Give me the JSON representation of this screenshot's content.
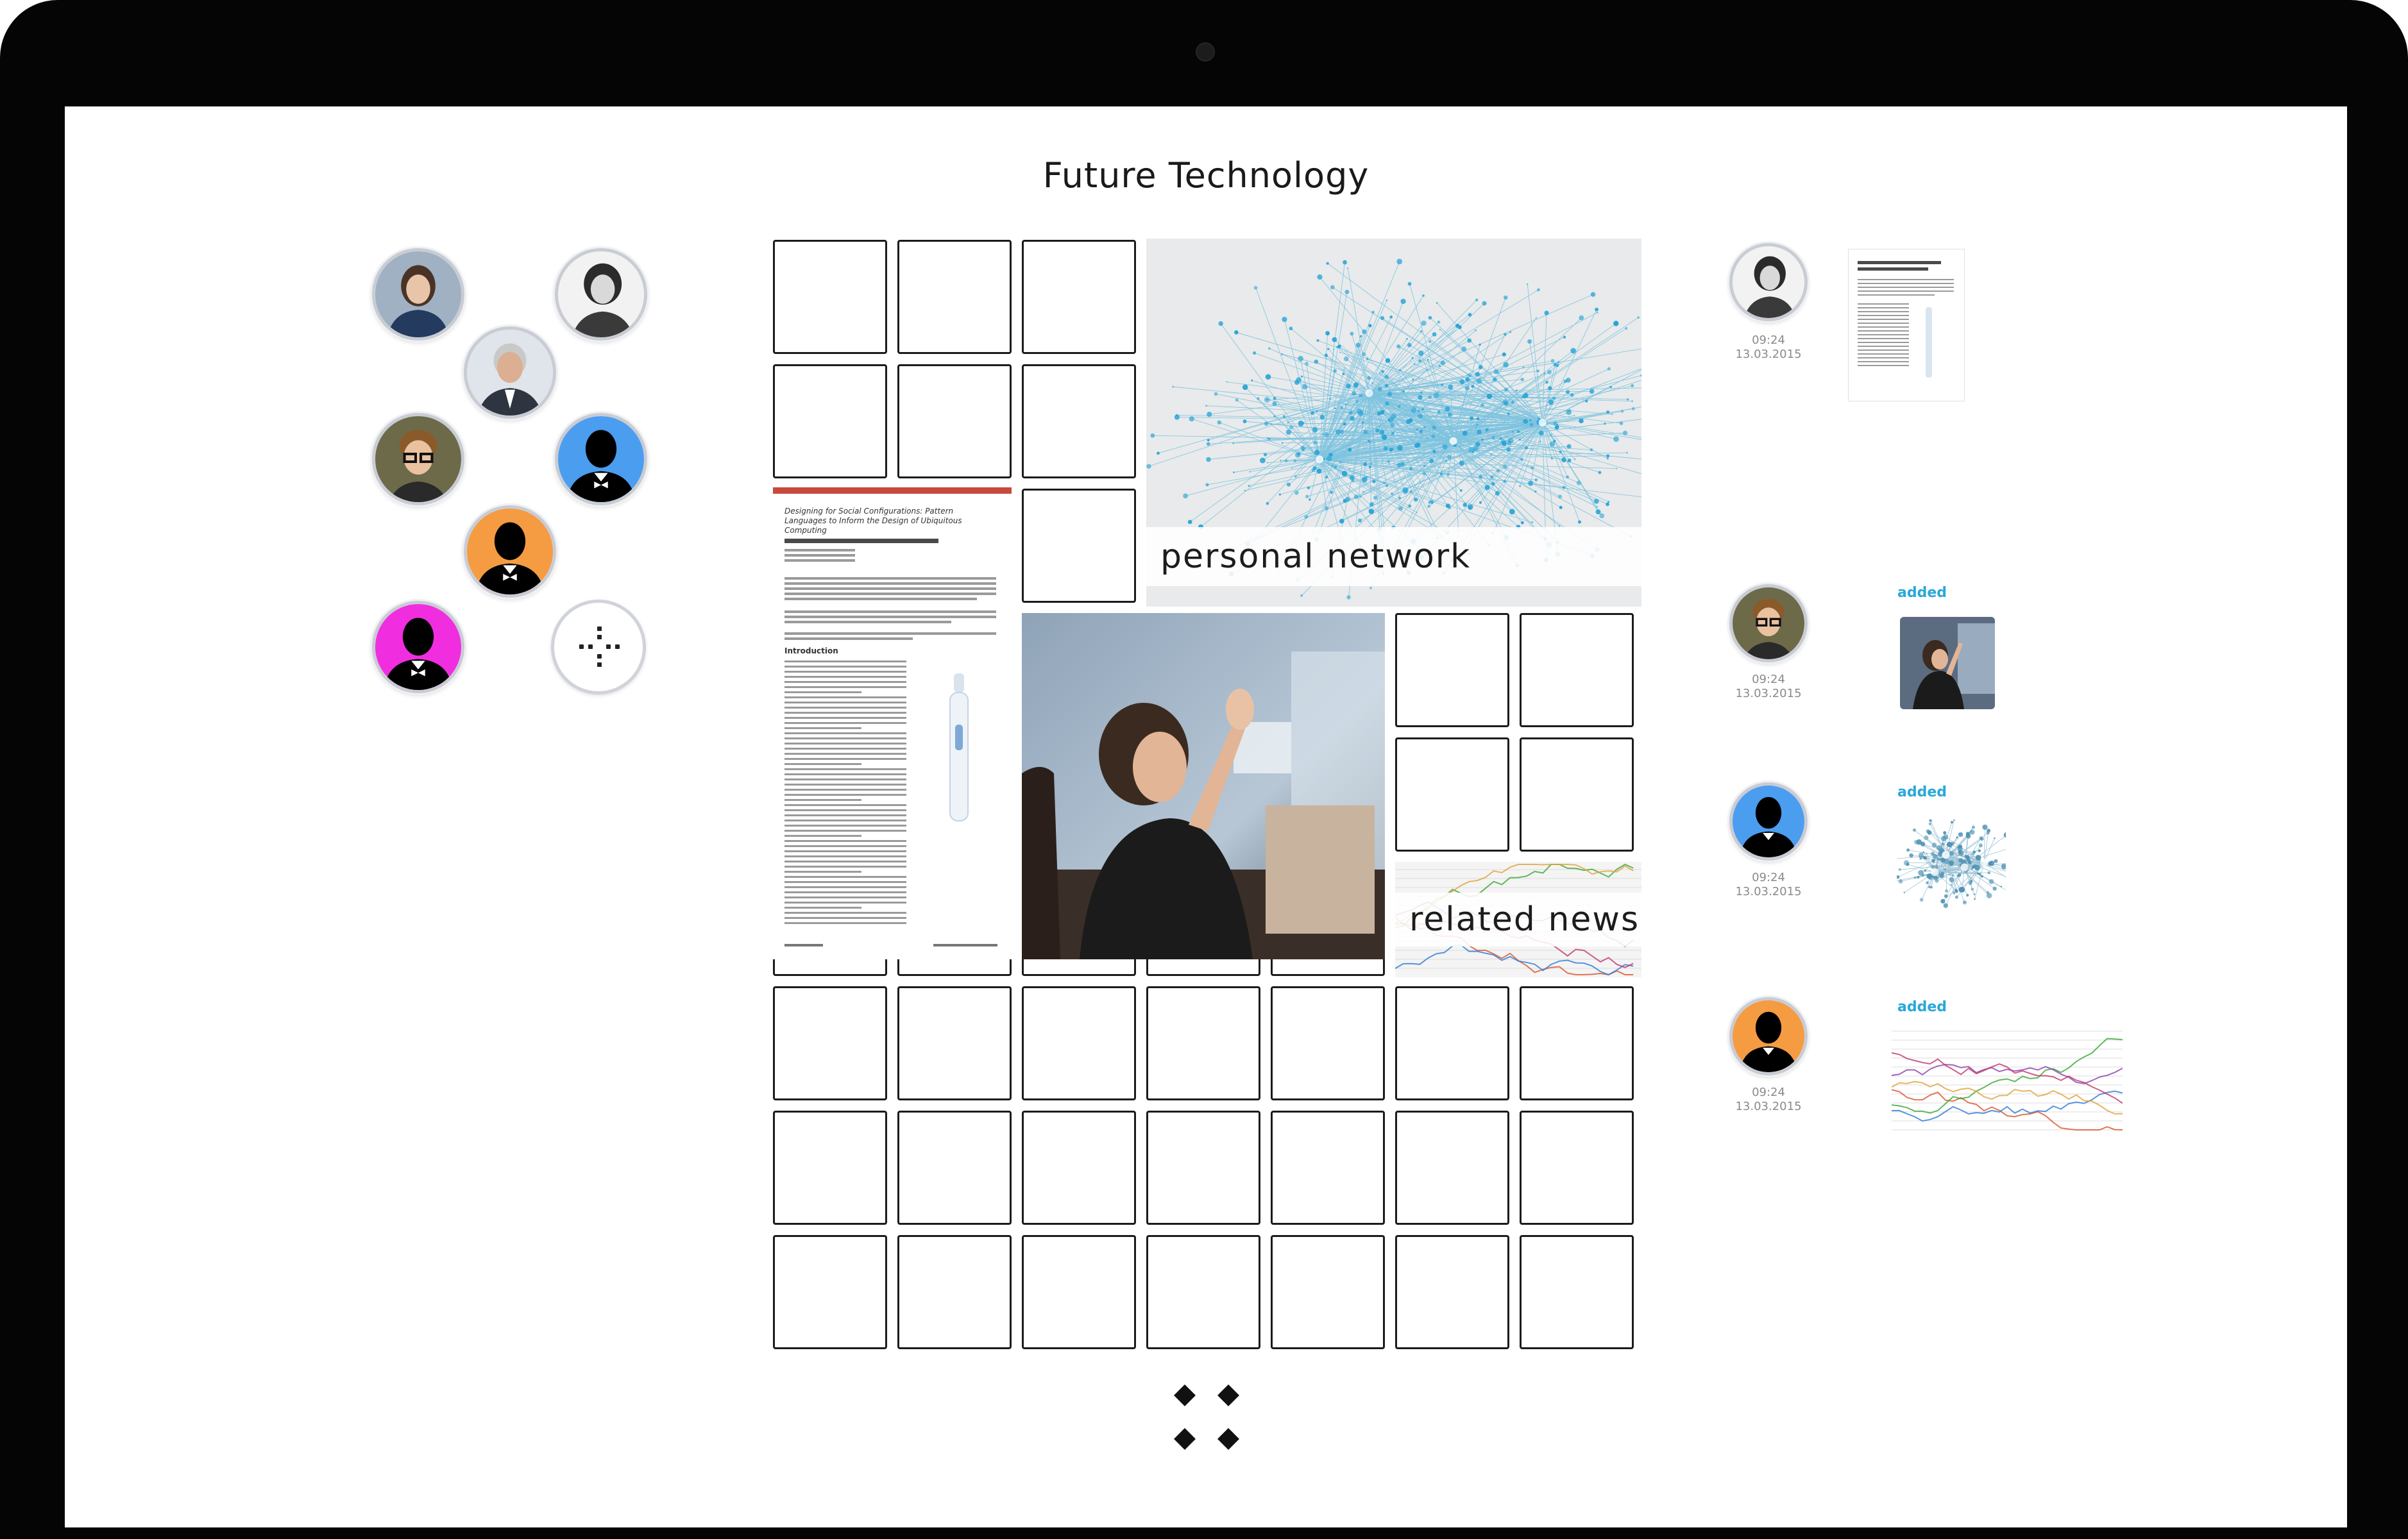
{
  "board": {
    "title": "Future Technology"
  },
  "members": [
    {
      "name": "member-1",
      "color": "#3d5a80"
    },
    {
      "name": "member-2",
      "color": "#d8d8d8"
    },
    {
      "name": "member-3",
      "color": "#b8c2cc"
    },
    {
      "name": "member-4",
      "color": "#6d6a4a"
    },
    {
      "name": "member-5",
      "color": "#4b9df0"
    },
    {
      "name": "member-6",
      "color": "#f59b42"
    },
    {
      "name": "member-7",
      "color": "#f02ee0"
    }
  ],
  "tiles": {
    "network": {
      "label": "personal network",
      "accent": "#2aa5d6"
    },
    "document": {
      "title": "Designing for Social Configurations: Pattern Languages to Inform the Design of Ubiquitous Computing",
      "section": "Introduction"
    },
    "news": {
      "label": "related news"
    }
  },
  "feed": [
    {
      "time": "09:24",
      "date": "13.03.2015",
      "action": "",
      "thumb": "document",
      "avatar_color": "#d8d8d8"
    },
    {
      "time": "09:24",
      "date": "13.03.2015",
      "action": "added",
      "thumb": "photo",
      "avatar_color": "#6d6a4a"
    },
    {
      "time": "09:24",
      "date": "13.03.2015",
      "action": "added",
      "thumb": "network",
      "avatar_color": "#4b9df0"
    },
    {
      "time": "09:24",
      "date": "13.03.2015",
      "action": "added",
      "thumb": "chart",
      "avatar_color": "#f59b42"
    }
  ],
  "icons": {
    "add_member": "add-member-icon",
    "menu": "menu-diamonds-icon"
  },
  "colors": {
    "accent": "#2aa8d8",
    "cell_border": "#1b1b1b"
  }
}
